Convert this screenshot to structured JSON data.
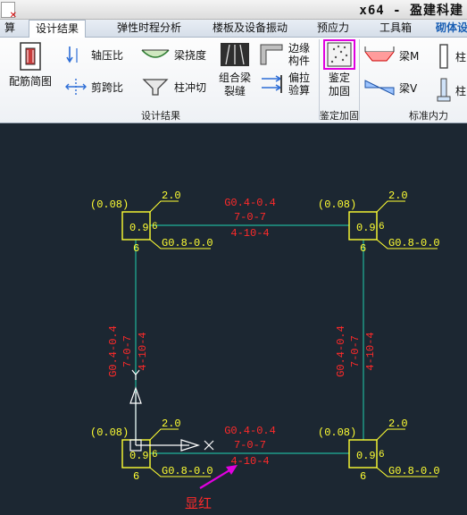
{
  "title": "x64 - 盈建科建",
  "tabs": [
    {
      "label": "算"
    },
    {
      "label": "设计结果"
    },
    {
      "label": "弹性时程分析"
    },
    {
      "label": "楼板及设备振动"
    },
    {
      "label": "预应力"
    },
    {
      "label": "工具箱"
    },
    {
      "label": "砌体设"
    }
  ],
  "ribbon": {
    "rebar_diagram": "配筋简图",
    "axial_ratio": "轴压比",
    "shear_span_ratio": "剪跨比",
    "beam_deflection": "梁挠度",
    "column_punching": "柱冲切",
    "combined_beam_line1": "组合梁",
    "combined_beam_line2": "裂缝",
    "edge_member_line1": "边缘",
    "edge_member_line2": "构件",
    "eccentric_line1": "偏拉",
    "eccentric_line2": "验算",
    "appraisal_line1": "鉴定",
    "appraisal_line2": "加固",
    "beam_m": "梁M",
    "beam_v": "梁V",
    "col_trunc": "柱",
    "group_design": "设计结果",
    "group_appraisal": "鉴定加固",
    "group_std": "标准内力"
  },
  "drawing": {
    "columns": [
      {
        "ratio": "0.9",
        "top_label": "(0.08)",
        "corner_value": "2.0",
        "right_value": "6",
        "bottom_value": "6",
        "detail": "G0.8-0.0"
      },
      {
        "ratio": "0.9",
        "top_label": "(0.08)",
        "corner_value": "2.0",
        "right_value": "6",
        "bottom_value": "6",
        "detail": "G0.8-0.0"
      },
      {
        "ratio": "0.9",
        "top_label": "(0.08)",
        "corner_value": "2.0",
        "right_value": "6",
        "bottom_value": "6",
        "detail": "G0.8-0.0"
      },
      {
        "ratio": "0.9",
        "top_label": "(0.08)",
        "corner_value": "2.0",
        "right_value": "6",
        "bottom_value": "6",
        "detail": "G0.8-0.0"
      }
    ],
    "beams": [
      {
        "line1": "G0.4-0.4",
        "line2": "7-0-7",
        "line3": "4-10-4"
      },
      {
        "line1": "G0.4-0.4",
        "line2": "7-0-7",
        "line3": "4-10-4"
      },
      {
        "line1": "G0.4-0.4",
        "line2": "7-0-7",
        "line3": "4-10-4"
      },
      {
        "line1": "G0.4-0.4",
        "line2": "7-0-7",
        "line3": "4-10-4"
      }
    ],
    "note": "显红",
    "colors": {
      "beam_line": "#1fb39a",
      "column": "#ffff33",
      "beam_text": "#ff2a2a",
      "axis": "#ffffff",
      "arrow": "#e000e0"
    }
  }
}
